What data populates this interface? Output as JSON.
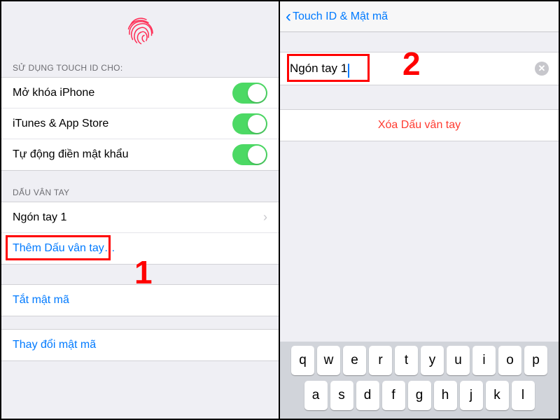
{
  "left": {
    "section1_header": "SỬ DỤNG TOUCH ID CHO:",
    "toggles": [
      {
        "label": "Mở khóa iPhone"
      },
      {
        "label": "iTunes & App Store"
      },
      {
        "label": "Tự động điền mật khẩu"
      }
    ],
    "section2_header": "DẤU VÂN TAY",
    "finger_label": "Ngón tay 1",
    "add_finger": "Thêm Dấu vân tay…",
    "turn_off": "Tắt mật mã",
    "change": "Thay đổi mật mã"
  },
  "right": {
    "back_label": "Touch ID & Mật mã",
    "finger_name": "Ngón tay 1",
    "delete_label": "Xóa Dấu vân tay"
  },
  "keyboard_rows": [
    [
      "q",
      "w",
      "e",
      "r",
      "t",
      "y",
      "u",
      "i",
      "o",
      "p"
    ],
    [
      "a",
      "s",
      "d",
      "f",
      "g",
      "h",
      "j",
      "k",
      "l"
    ]
  ],
  "annotations": {
    "num1": "1",
    "num2": "2"
  }
}
